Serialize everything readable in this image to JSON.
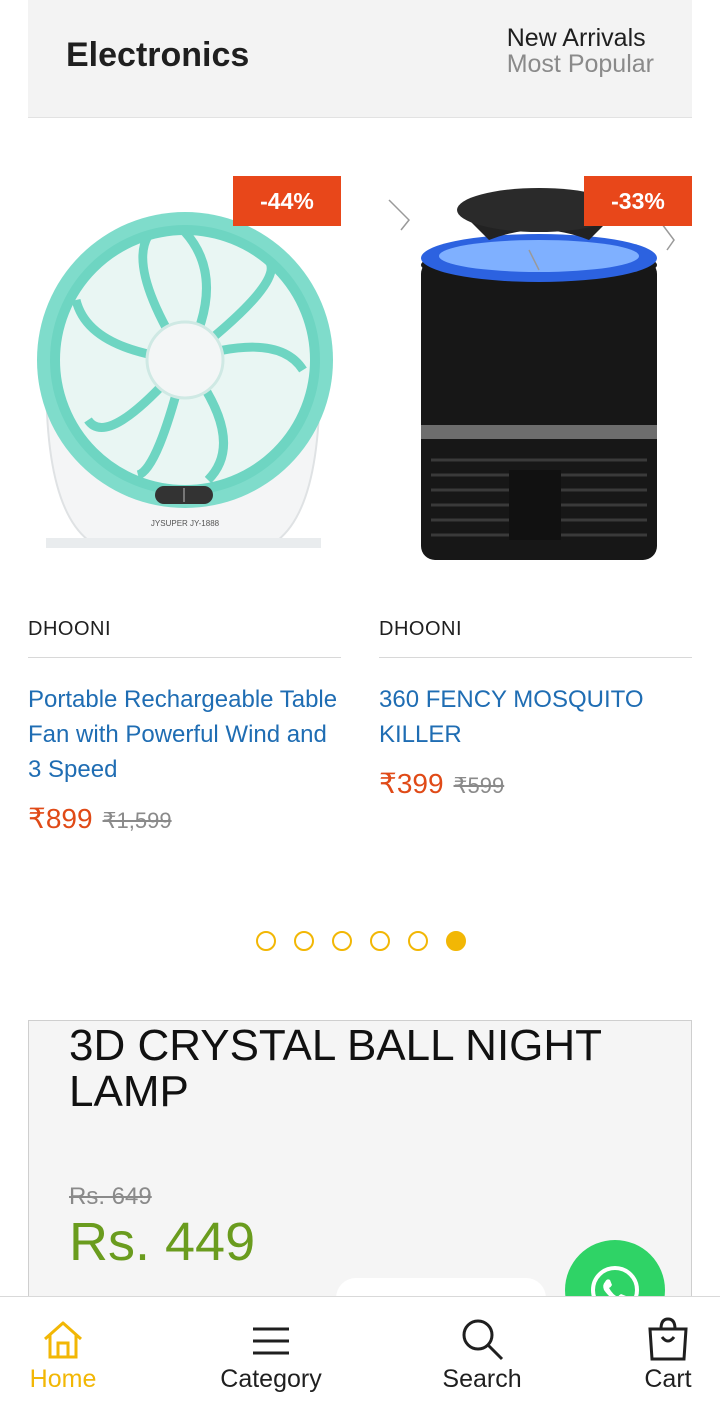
{
  "section": {
    "title": "Electronics",
    "sort_options": {
      "new_arrivals": "New Arrivals",
      "most_popular": "Most Popular"
    }
  },
  "products": [
    {
      "discount": "-44%",
      "brand": "DHOONI",
      "name": "Portable Rechargeable Table Fan with Powerful Wind and 3 Speed",
      "price": "₹899",
      "original_price": "₹1,599",
      "image_text": "JYSUPER JY-1888",
      "image_icon": "table-fan-image"
    },
    {
      "discount": "-33%",
      "brand": "DHOONI",
      "name": "360 FENCY MOSQUITO KILLER",
      "price": "₹399",
      "original_price": "₹599",
      "image_icon": "mosquito-killer-image"
    }
  ],
  "carousel": {
    "page_count": 6,
    "active_index": 5
  },
  "promo": {
    "title": "3D CRYSTAL BALL NIGHT LAMP",
    "original_price": "Rs. 649",
    "price": "Rs. 449"
  },
  "bottom_nav": [
    {
      "label": "Home",
      "icon": "home-icon",
      "active": true
    },
    {
      "label": "Category",
      "icon": "menu-icon",
      "active": false
    },
    {
      "label": "Search",
      "icon": "search-icon",
      "active": false
    },
    {
      "label": "Cart",
      "icon": "shopping-bag-icon",
      "active": false
    }
  ],
  "colors": {
    "accent": "#f2b705",
    "discount": "#e8471a",
    "price": "#e04a17",
    "link": "#1f6db3",
    "promo_price": "#6a9c1e",
    "whatsapp": "#2fd366"
  }
}
